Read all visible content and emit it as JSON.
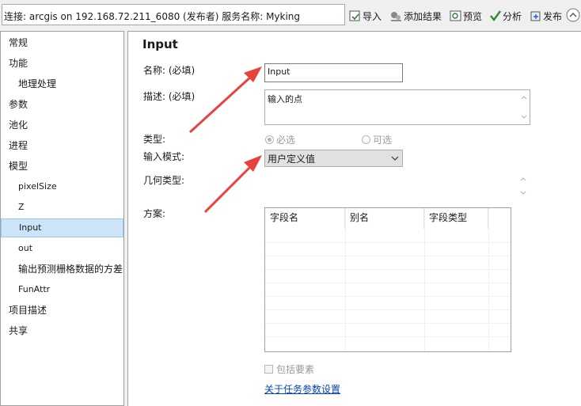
{
  "toolbar": {
    "connection_text": "连接: arcgis on 192.168.72.211_6080 (发布者)    服务名称: Myking",
    "import_label": "导入",
    "add_result_label": "添加结果",
    "preview_label": "预览",
    "analyze_label": "分析",
    "publish_label": "发布"
  },
  "nav": {
    "items": [
      {
        "label": "常规"
      },
      {
        "label": "功能"
      },
      {
        "label": "地理处理"
      },
      {
        "label": "参数"
      },
      {
        "label": "池化"
      },
      {
        "label": "进程"
      },
      {
        "label": "模型"
      },
      {
        "label": "pixelSize"
      },
      {
        "label": "Z"
      },
      {
        "label": "Input"
      },
      {
        "label": "out"
      },
      {
        "label": "输出预测栅格数据的方差"
      },
      {
        "label": "FunAttr"
      },
      {
        "label": "项目描述"
      },
      {
        "label": "共享"
      }
    ]
  },
  "panel": {
    "title": "Input",
    "name_label": "名称: (必填)",
    "name_value": "Input",
    "desc_label": "描述: (必填)",
    "desc_value": "输入的点",
    "type_label": "类型:",
    "type_required": "必选",
    "type_optional": "可选",
    "input_mode_label": "输入模式:",
    "input_mode_value": "用户定义值",
    "geometry_label": "几何类型:",
    "schema_label": "方案:",
    "grid_headers": [
      "字段名",
      "别名",
      "字段类型"
    ],
    "include_features_label": "包括要素",
    "task_param_link": "关于任务参数设置"
  },
  "colors": {
    "arrow": "#e8423a",
    "selection": "#cce4f7",
    "link": "#0645ad"
  }
}
